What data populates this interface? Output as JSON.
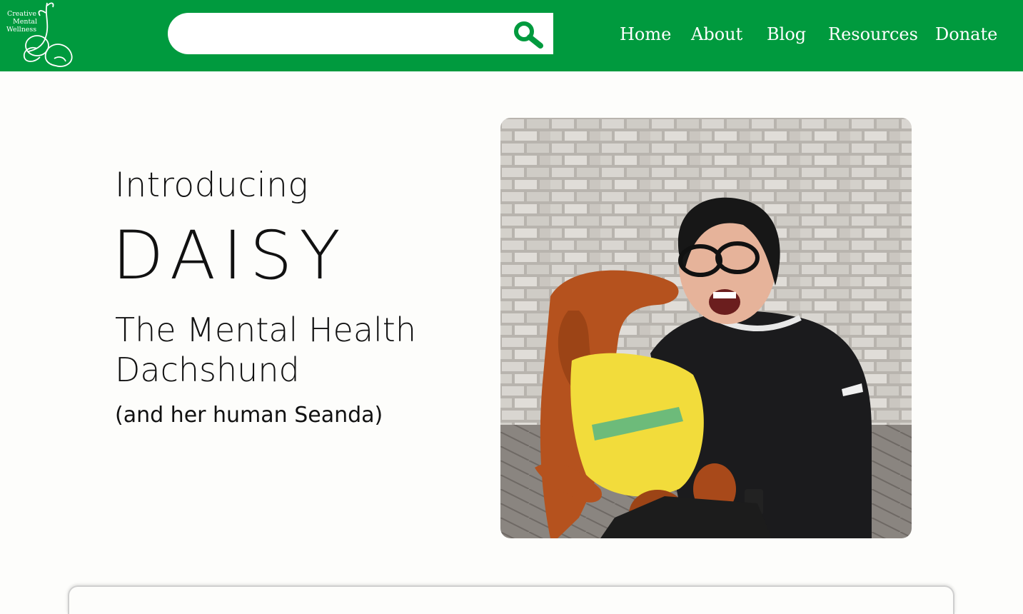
{
  "logo": {
    "line1": "Creative",
    "line2": "Mental",
    "line3": "Wellness"
  },
  "search": {
    "value": "",
    "placeholder": "",
    "icon": "search-icon"
  },
  "nav": {
    "items": [
      {
        "label": "Home"
      },
      {
        "label": "About"
      },
      {
        "label": "Blog"
      },
      {
        "label": "Resources"
      },
      {
        "label": "Donate"
      }
    ]
  },
  "hero": {
    "intro": "Introducing",
    "name": "DAISY",
    "subtitle": "The Mental Health Dachshund",
    "human": "(and her human Seanda)"
  },
  "colors": {
    "brand": "#009a3e",
    "background": "#fdfdfb",
    "text": "#111111"
  }
}
